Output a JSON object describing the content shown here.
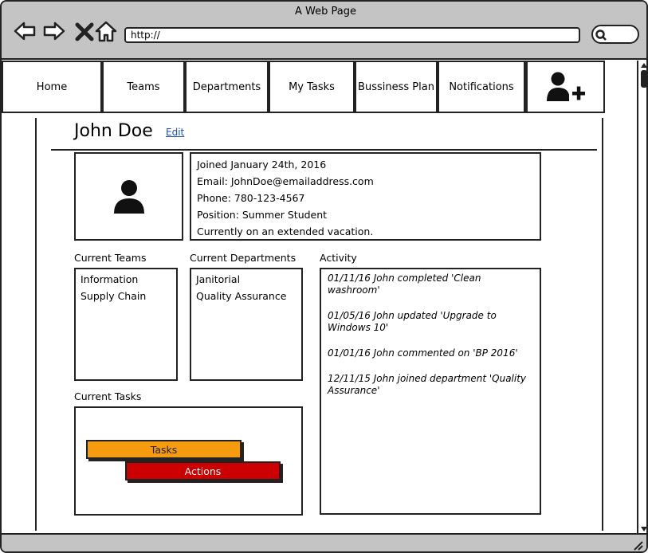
{
  "window": {
    "title": "A Web Page",
    "url": "http://"
  },
  "nav": {
    "items": [
      "Home",
      "Teams",
      "Departments",
      "My Tasks",
      "Bussiness Plan",
      "Notifications"
    ]
  },
  "profile": {
    "name": "John Doe",
    "edit_label": "Edit",
    "info": [
      "Joined January 24th, 2016",
      "Email: JohnDoe@emailaddress.com",
      "Phone: 780-123-4567",
      "Position: Summer Student",
      "Currently on an extended vacation."
    ]
  },
  "teams": {
    "label": "Current Teams",
    "items": [
      "Information",
      "Supply Chain"
    ]
  },
  "departments": {
    "label": "Current Departments",
    "items": [
      "Janitorial",
      "Quality Assurance"
    ]
  },
  "activity": {
    "label": "Activity",
    "items": [
      "01/11/16 John completed 'Clean washroom'",
      "01/05/16 John updated 'Upgrade to Windows 10'",
      "01/01/16 John commented on 'BP 2016'",
      "12/11/15 John joined department 'Quality Assurance'"
    ]
  },
  "tasks": {
    "label": "Current Tasks",
    "tasks_button": "Tasks",
    "actions_button": "Actions"
  },
  "colors": {
    "tasks": "#f59b0f",
    "actions": "#cc0000",
    "chrome": "#c4c4c4",
    "link": "#1a4fb8"
  },
  "icons": {
    "back": "arrow-left-icon",
    "forward": "arrow-right-icon",
    "stop": "close-icon",
    "home": "home-icon",
    "search": "search-icon",
    "add_user": "add-user-icon",
    "avatar": "user-icon"
  }
}
